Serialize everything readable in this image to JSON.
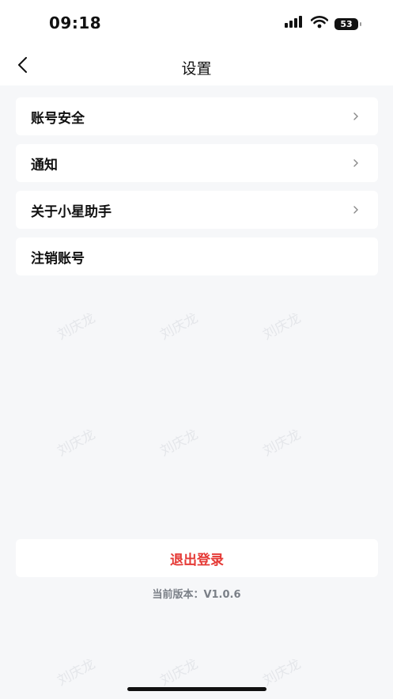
{
  "status_bar": {
    "time": "09:18",
    "battery": "53",
    "signal_icon": "cellular-signal-icon",
    "wifi_icon": "wifi-icon"
  },
  "nav": {
    "title": "设置",
    "back_icon": "chevron-left-icon"
  },
  "menu": {
    "items": [
      {
        "label": "账号安全",
        "has_chevron": true
      },
      {
        "label": "通知",
        "has_chevron": true
      },
      {
        "label": "关于小星助手",
        "has_chevron": true
      },
      {
        "label": "注销账号",
        "has_chevron": false
      }
    ]
  },
  "logout": {
    "label": "退出登录",
    "color": "#e53935"
  },
  "version": {
    "text": "当前版本：V1.0.6"
  },
  "watermark": {
    "text": "刘庆龙"
  }
}
